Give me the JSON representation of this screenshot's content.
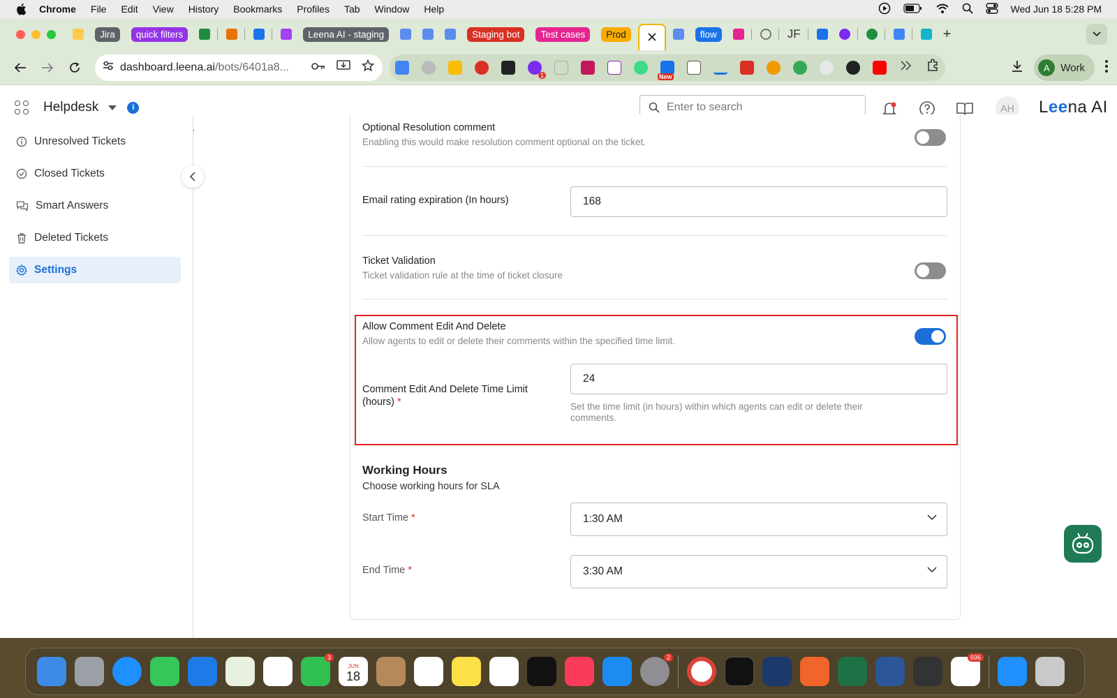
{
  "menubar": {
    "app": "Chrome",
    "items": [
      "File",
      "Edit",
      "View",
      "History",
      "Bookmarks",
      "Profiles",
      "Tab",
      "Window",
      "Help"
    ],
    "clock": "Wed Jun 18  5:28 PM"
  },
  "tabs": [
    {
      "type": "chip",
      "label": "Jira",
      "color": "#5f6368"
    },
    {
      "type": "chip",
      "label": "quick filters",
      "color": "#9334e6"
    },
    {
      "type": "chip",
      "label": "Leena AI - staging",
      "color": "#5f6368"
    },
    {
      "type": "chip",
      "label": "Staging bot",
      "color": "#d93025"
    },
    {
      "type": "chip",
      "label": "Test cases",
      "color": "#e52592"
    },
    {
      "type": "chip",
      "label": "Prod",
      "color": "#f9ab00"
    },
    {
      "type": "chip",
      "label": "flow",
      "color": "#1a73e8"
    },
    {
      "type": "text",
      "label": "JF"
    }
  ],
  "omnibox": {
    "host": "dashboard.leena.ai",
    "path": "/bots/6401a8..."
  },
  "profile": {
    "initial": "A",
    "name": "Work"
  },
  "header": {
    "app_name": "Helpdesk",
    "search_placeholder": "Enter to search",
    "avatar_initials": "AH",
    "logo_pre": "L",
    "logo_ee": "ee",
    "logo_post": "na AI"
  },
  "sidebar": {
    "items": [
      {
        "label": "Unresolved Tickets",
        "icon": "info-circle-icon"
      },
      {
        "label": "Closed Tickets",
        "icon": "check-circle-icon"
      },
      {
        "label": "Smart Answers",
        "icon": "chat-bubbles-icon"
      },
      {
        "label": "Deleted Tickets",
        "icon": "trash-icon"
      },
      {
        "label": "Settings",
        "icon": "gear-icon",
        "active": true
      }
    ]
  },
  "settings": {
    "optional_resolution": {
      "title": "Optional Resolution comment",
      "desc": "Enabling this would make resolution comment optional on the ticket.",
      "enabled": false
    },
    "email_rating": {
      "label": "Email rating expiration (In hours)",
      "value": "168"
    },
    "ticket_validation": {
      "title": "Ticket Validation",
      "desc": "Ticket validation rule at the time of ticket closure",
      "enabled": false
    },
    "comment_edit": {
      "title": "Allow Comment Edit And Delete",
      "desc": "Allow agents to edit or delete their comments within the specified time limit.",
      "enabled": true,
      "limit_label_line1": "Comment Edit And Delete Time Limit",
      "limit_label_line2": "(hours)",
      "required_mark": "*",
      "limit_value": "24",
      "limit_help_line1": "Set the time limit (in hours) within which agents can edit or delete their",
      "limit_help_line2": "comments."
    },
    "working_hours": {
      "title": "Working Hours",
      "desc": "Choose working hours for SLA",
      "start_label": "Start Time",
      "start_value": "1:30 AM",
      "end_label": "End Time",
      "end_value": "3:30 AM",
      "required_mark": "*"
    }
  },
  "dock": {
    "badges": {
      "facetime": "3",
      "settings": "2",
      "slack": "696"
    },
    "calendar_month": "JUN",
    "calendar_day": "18"
  },
  "colors": {
    "accent": "#1d6fd8",
    "highlight": "#e02424",
    "toolbar_bg": "#dfe9d8"
  }
}
